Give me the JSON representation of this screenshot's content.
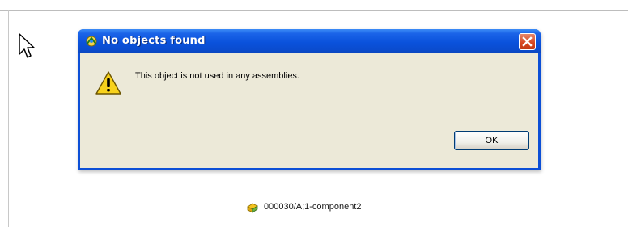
{
  "dialog": {
    "title": "No objects found",
    "message": "This object is not used in any assemblies.",
    "ok_label": "OK"
  },
  "background": {
    "node_label": "000030/A;1-component2"
  },
  "colors": {
    "titlebar": "#0a52dc",
    "dialog_body": "#ece9d8",
    "close_button": "#d6451f"
  },
  "icons": {
    "title": "app-icon",
    "close": "close-icon",
    "warning": "warning-icon",
    "node": "part-icon",
    "cursor": "mouse-pointer-icon"
  }
}
